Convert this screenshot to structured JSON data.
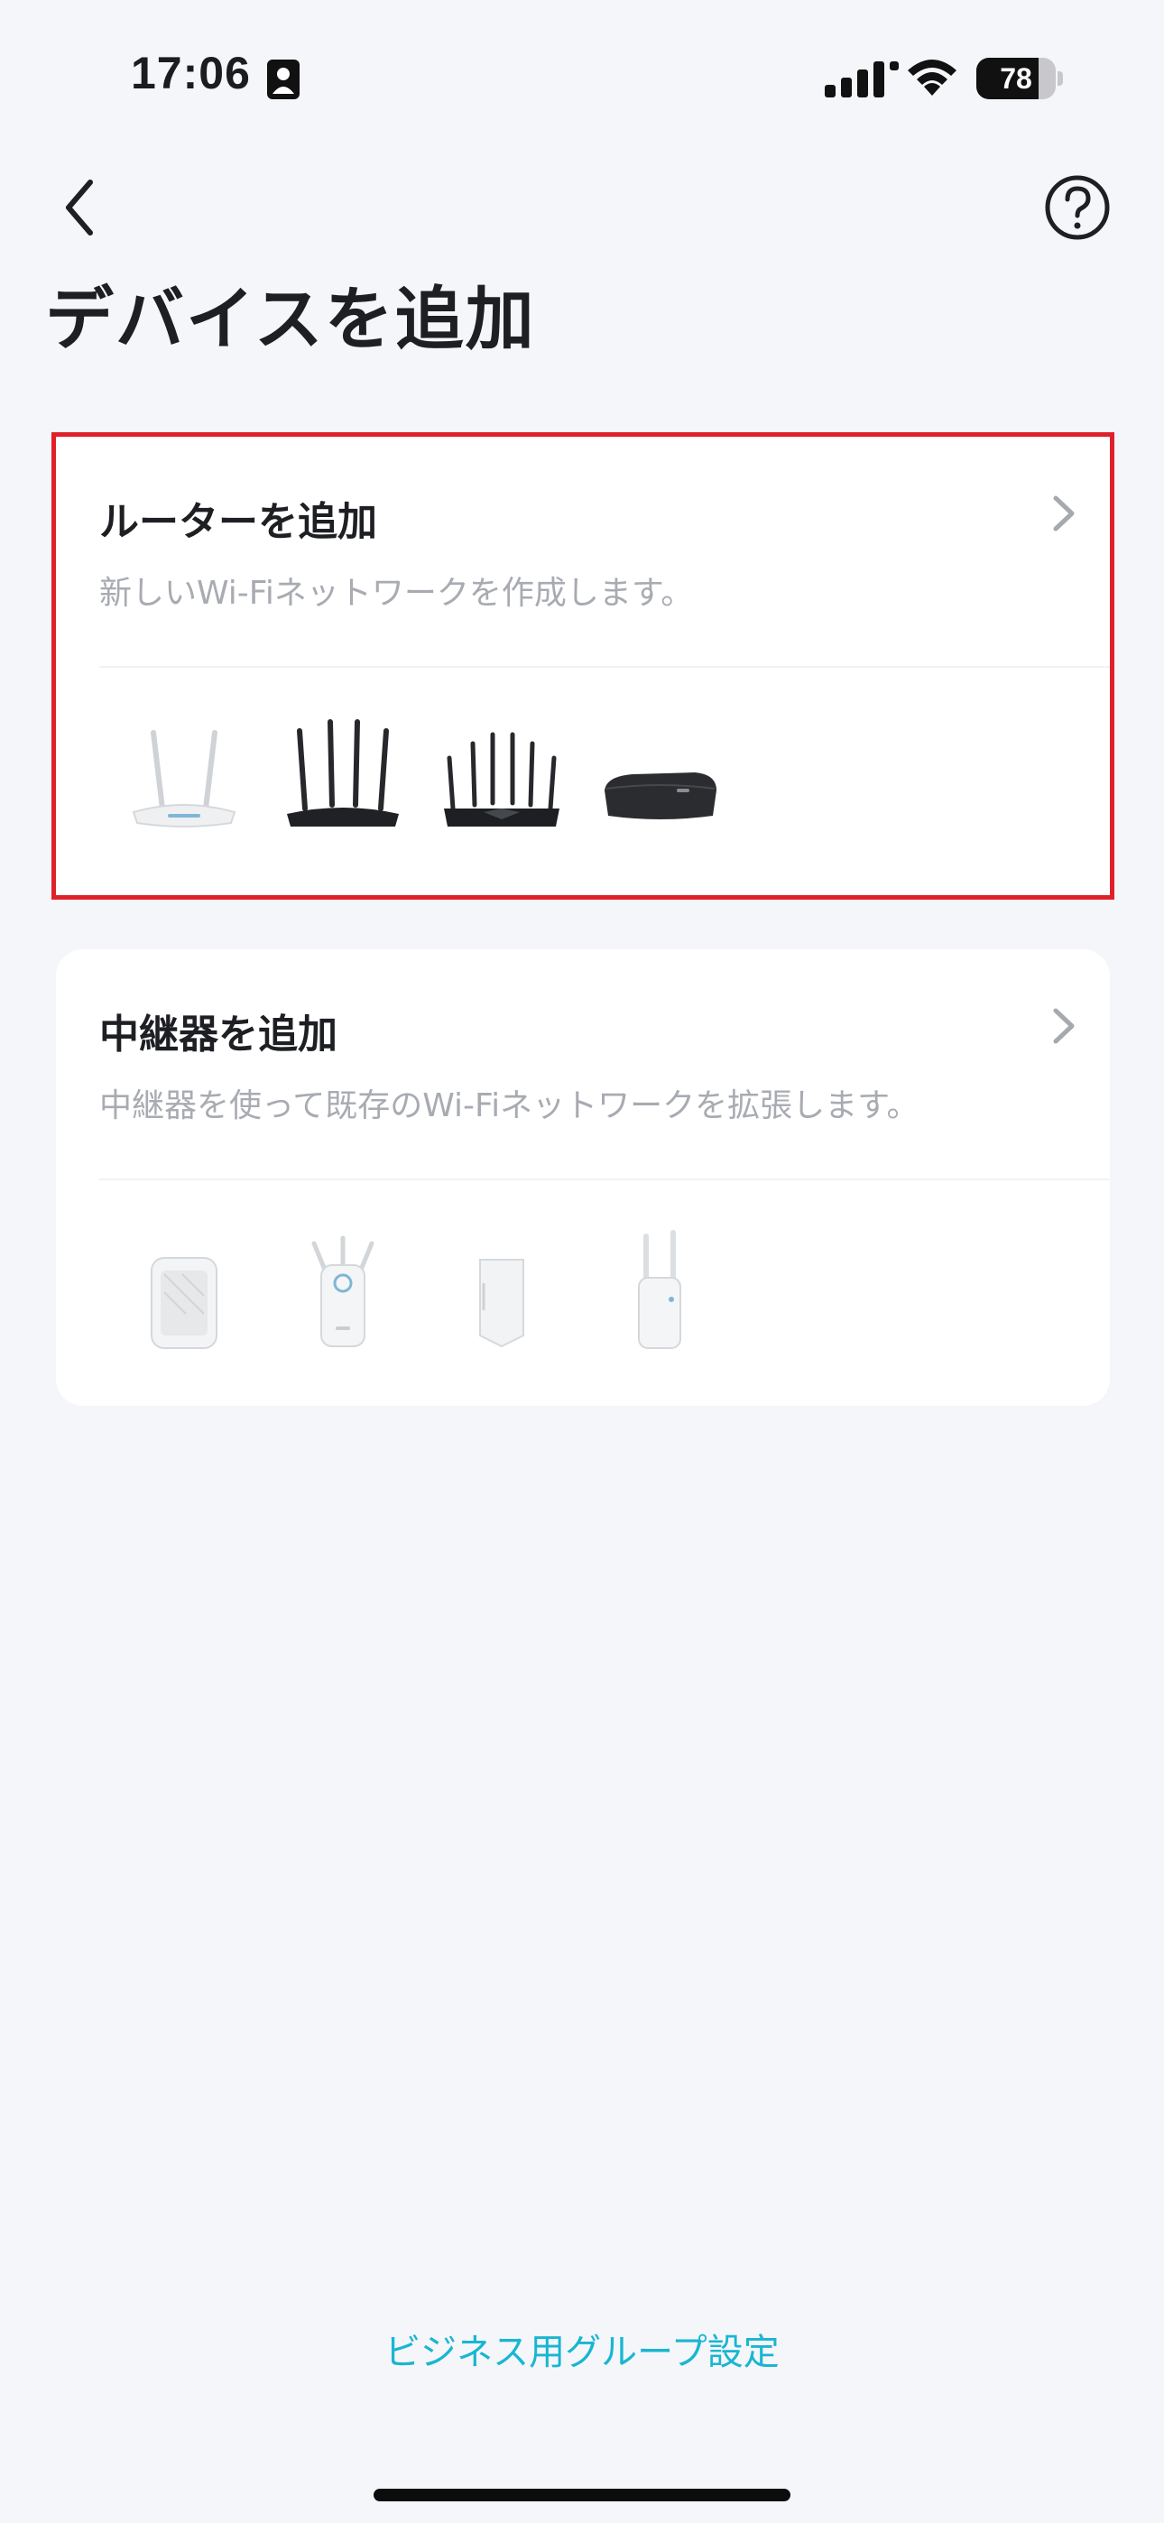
{
  "status_bar": {
    "time": "17:06",
    "battery_level": "78",
    "battery_fraction": 0.78
  },
  "page": {
    "title": "デバイスを追加"
  },
  "cards": {
    "router": {
      "title": "ルーターを追加",
      "description": "新しいWi-Fiネットワークを作成します。",
      "devices": [
        "white-router-2-antenna",
        "black-router-4-antenna",
        "black-router-6-antenna",
        "black-router-compact"
      ]
    },
    "extender": {
      "title": "中継器を追加",
      "description": "中継器を使って既存のWi-Fiネットワークを拡張します。",
      "devices": [
        "extender-compact",
        "extender-3-antenna",
        "extender-slim",
        "extender-2-antenna"
      ]
    }
  },
  "footer": {
    "business_link": "ビジネス用グループ設定"
  },
  "colors": {
    "background": "#f4f6fa",
    "card": "#ffffff",
    "highlight_border": "#e0202a",
    "link": "#19b6d0",
    "secondary_text": "#a8abb1"
  }
}
